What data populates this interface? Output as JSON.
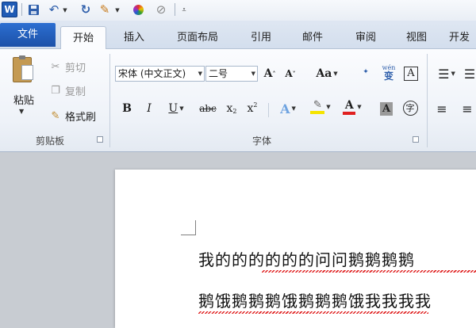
{
  "qat": {
    "app_icon_letter": "W",
    "save_icon": "save-icon",
    "undo_icon": "undo-icon",
    "repeat_icon": "repeat-icon",
    "format_painter_icon": "paintbrush-icon",
    "color_icon": "color-wheel-icon",
    "clear_icon": "strikethrough-icon"
  },
  "tabs": {
    "file": "文件",
    "home": "开始",
    "insert": "插入",
    "page_layout": "页面布局",
    "references": "引用",
    "mailings": "邮件",
    "review": "审阅",
    "view": "视图",
    "developer": "开发"
  },
  "clipboard": {
    "paste": "粘贴",
    "cut": "剪切",
    "copy": "复制",
    "format_painter": "格式刷",
    "group_label": "剪贴板"
  },
  "font": {
    "font_name": "宋体 (中文正文)",
    "font_size": "二号",
    "group_label": "字体",
    "grow": "A",
    "shrink": "A",
    "change_case": "Aa",
    "bold": "B",
    "italic": "I",
    "underline": "U",
    "strikethrough": "abc",
    "subscript": "x",
    "superscript": "x",
    "font_color_letter": "A",
    "char_shading_letter": "A",
    "border_letter": "A",
    "enclose_char": "字",
    "pinyin": "wén",
    "pinyin_base": "变"
  },
  "colors": {
    "accent_blue": "#1f5bb5",
    "highlight_yellow": "#f5e400",
    "font_color_red": "#e02020"
  },
  "document": {
    "line1": "我的的的的的的问问鹅鹅鹅鹅",
    "line2": "鹅饿鹅鹅鹅饿鹅鹅鹅饿我我我我"
  }
}
